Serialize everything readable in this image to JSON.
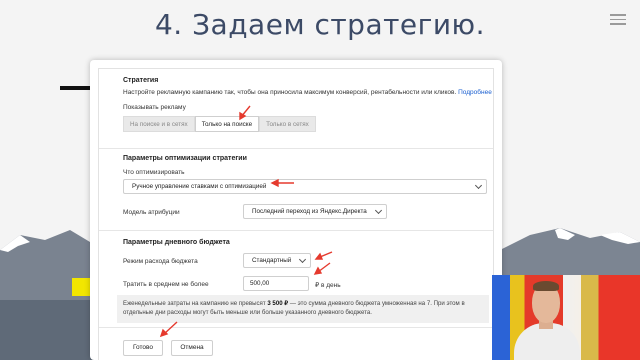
{
  "slide": {
    "title": "4. Задаем стратегию."
  },
  "strategy": {
    "heading": "Стратегия",
    "description": "Настройте рекламную кампанию так, чтобы она приносила максимум конверсий, рентабельности или кликов.",
    "more_link": "Подробнее",
    "show_ads_label": "Показывать рекламу",
    "options": [
      "На поиске и в сетях",
      "Только на поиске",
      "Только в сетях"
    ],
    "selected_option": "Только на поиске"
  },
  "optimization": {
    "heading": "Параметры оптимизации стратегии",
    "what_label": "Что оптимизировать",
    "what_value": "Ручное управление ставками с оптимизацией",
    "attribution_label": "Модель атрибуции",
    "attribution_value": "Последний переход из Яндекс.Директа"
  },
  "budget": {
    "heading": "Параметры дневного бюджета",
    "mode_label": "Режим расхода бюджета",
    "mode_value": "Стандартный",
    "spend_label": "Тратить в среднем не более",
    "spend_value": "500,00",
    "spend_unit": "₽ в день",
    "info_prefix": "Еженедельные затраты на кампанию не превысят",
    "info_amount": "3 500 ₽",
    "info_suffix": "— это сумма дневного бюджета умноженная на 7. При этом в отдельные дни расходы могут быть меньше или больше указанного дневного бюджета."
  },
  "footer": {
    "done_label": "Готово",
    "cancel_label": "Отмена"
  },
  "colors": {
    "title": "#3c4a66",
    "annotation_arrow": "#e53a2e",
    "link": "#1a5fd0"
  }
}
